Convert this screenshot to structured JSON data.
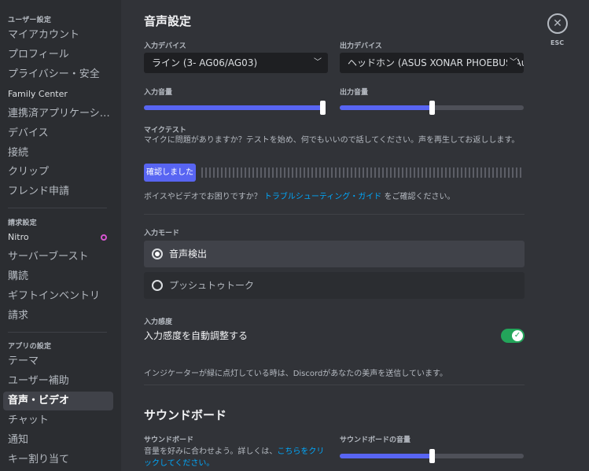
{
  "sidebar": {
    "user_settings_header": "ユーザー設定",
    "user_items": [
      "マイアカウント",
      "プロフィール",
      "プライバシー・安全",
      "Family Center",
      "連携済アプリケーション",
      "デバイス",
      "接続",
      "クリップ",
      "フレンド申請"
    ],
    "billing_header": "請求設定",
    "billing_items": [
      "Nitro",
      "サーバーブースト",
      "購読",
      "ギフトインベントリ",
      "請求"
    ],
    "app_header": "アプリの設定",
    "app_items": [
      "テーマ",
      "ユーザー補助",
      "音声・ビデオ",
      "チャット",
      "通知",
      "キー割り当て"
    ]
  },
  "voice": {
    "title": "音声設定",
    "input_device_label": "入力デバイス",
    "input_device_value": "ライン (3- AG06/AG03)",
    "output_device_label": "出力デバイス",
    "output_device_value": "ヘッドホン (ASUS XONAR PHOEBUS Audio)",
    "input_volume_label": "入力音量",
    "input_volume": 1.0,
    "output_volume_label": "出力音量",
    "output_volume": 0.5,
    "mic_test_label": "マイクテスト",
    "mic_test_desc": "マイクに問題がありますか？テストを始め、何でもいいので話してください。声を再生してお返しします。",
    "mic_test_button": "確認しました",
    "trouble_prefix": "ボイスやビデオでお困りですか？",
    "trouble_link": "トラブルシューティング・ガイド",
    "trouble_suffix": "をご確認ください。",
    "input_mode_label": "入力モード",
    "mode_voice": "音声検出",
    "mode_ptt": "プッシュトゥトーク",
    "sensitivity_label": "入力感度",
    "auto_sensitivity": "入力感度を自動調整する",
    "auto_sensitivity_on": true,
    "indicator_note": "インジケーターが緑に点灯している時は、Discordがあなたの美声を送信しています。"
  },
  "soundboard": {
    "title": "サウンドボード",
    "label": "サウンドボード",
    "desc_prefix": "音量を好みに合わせよう。詳しくは、",
    "desc_link": "こちらをクリックしてください。",
    "volume_label": "サウンドボードの音量",
    "volume": 0.5
  },
  "close": {
    "esc_label": "ESC",
    "icon": "close-icon"
  }
}
